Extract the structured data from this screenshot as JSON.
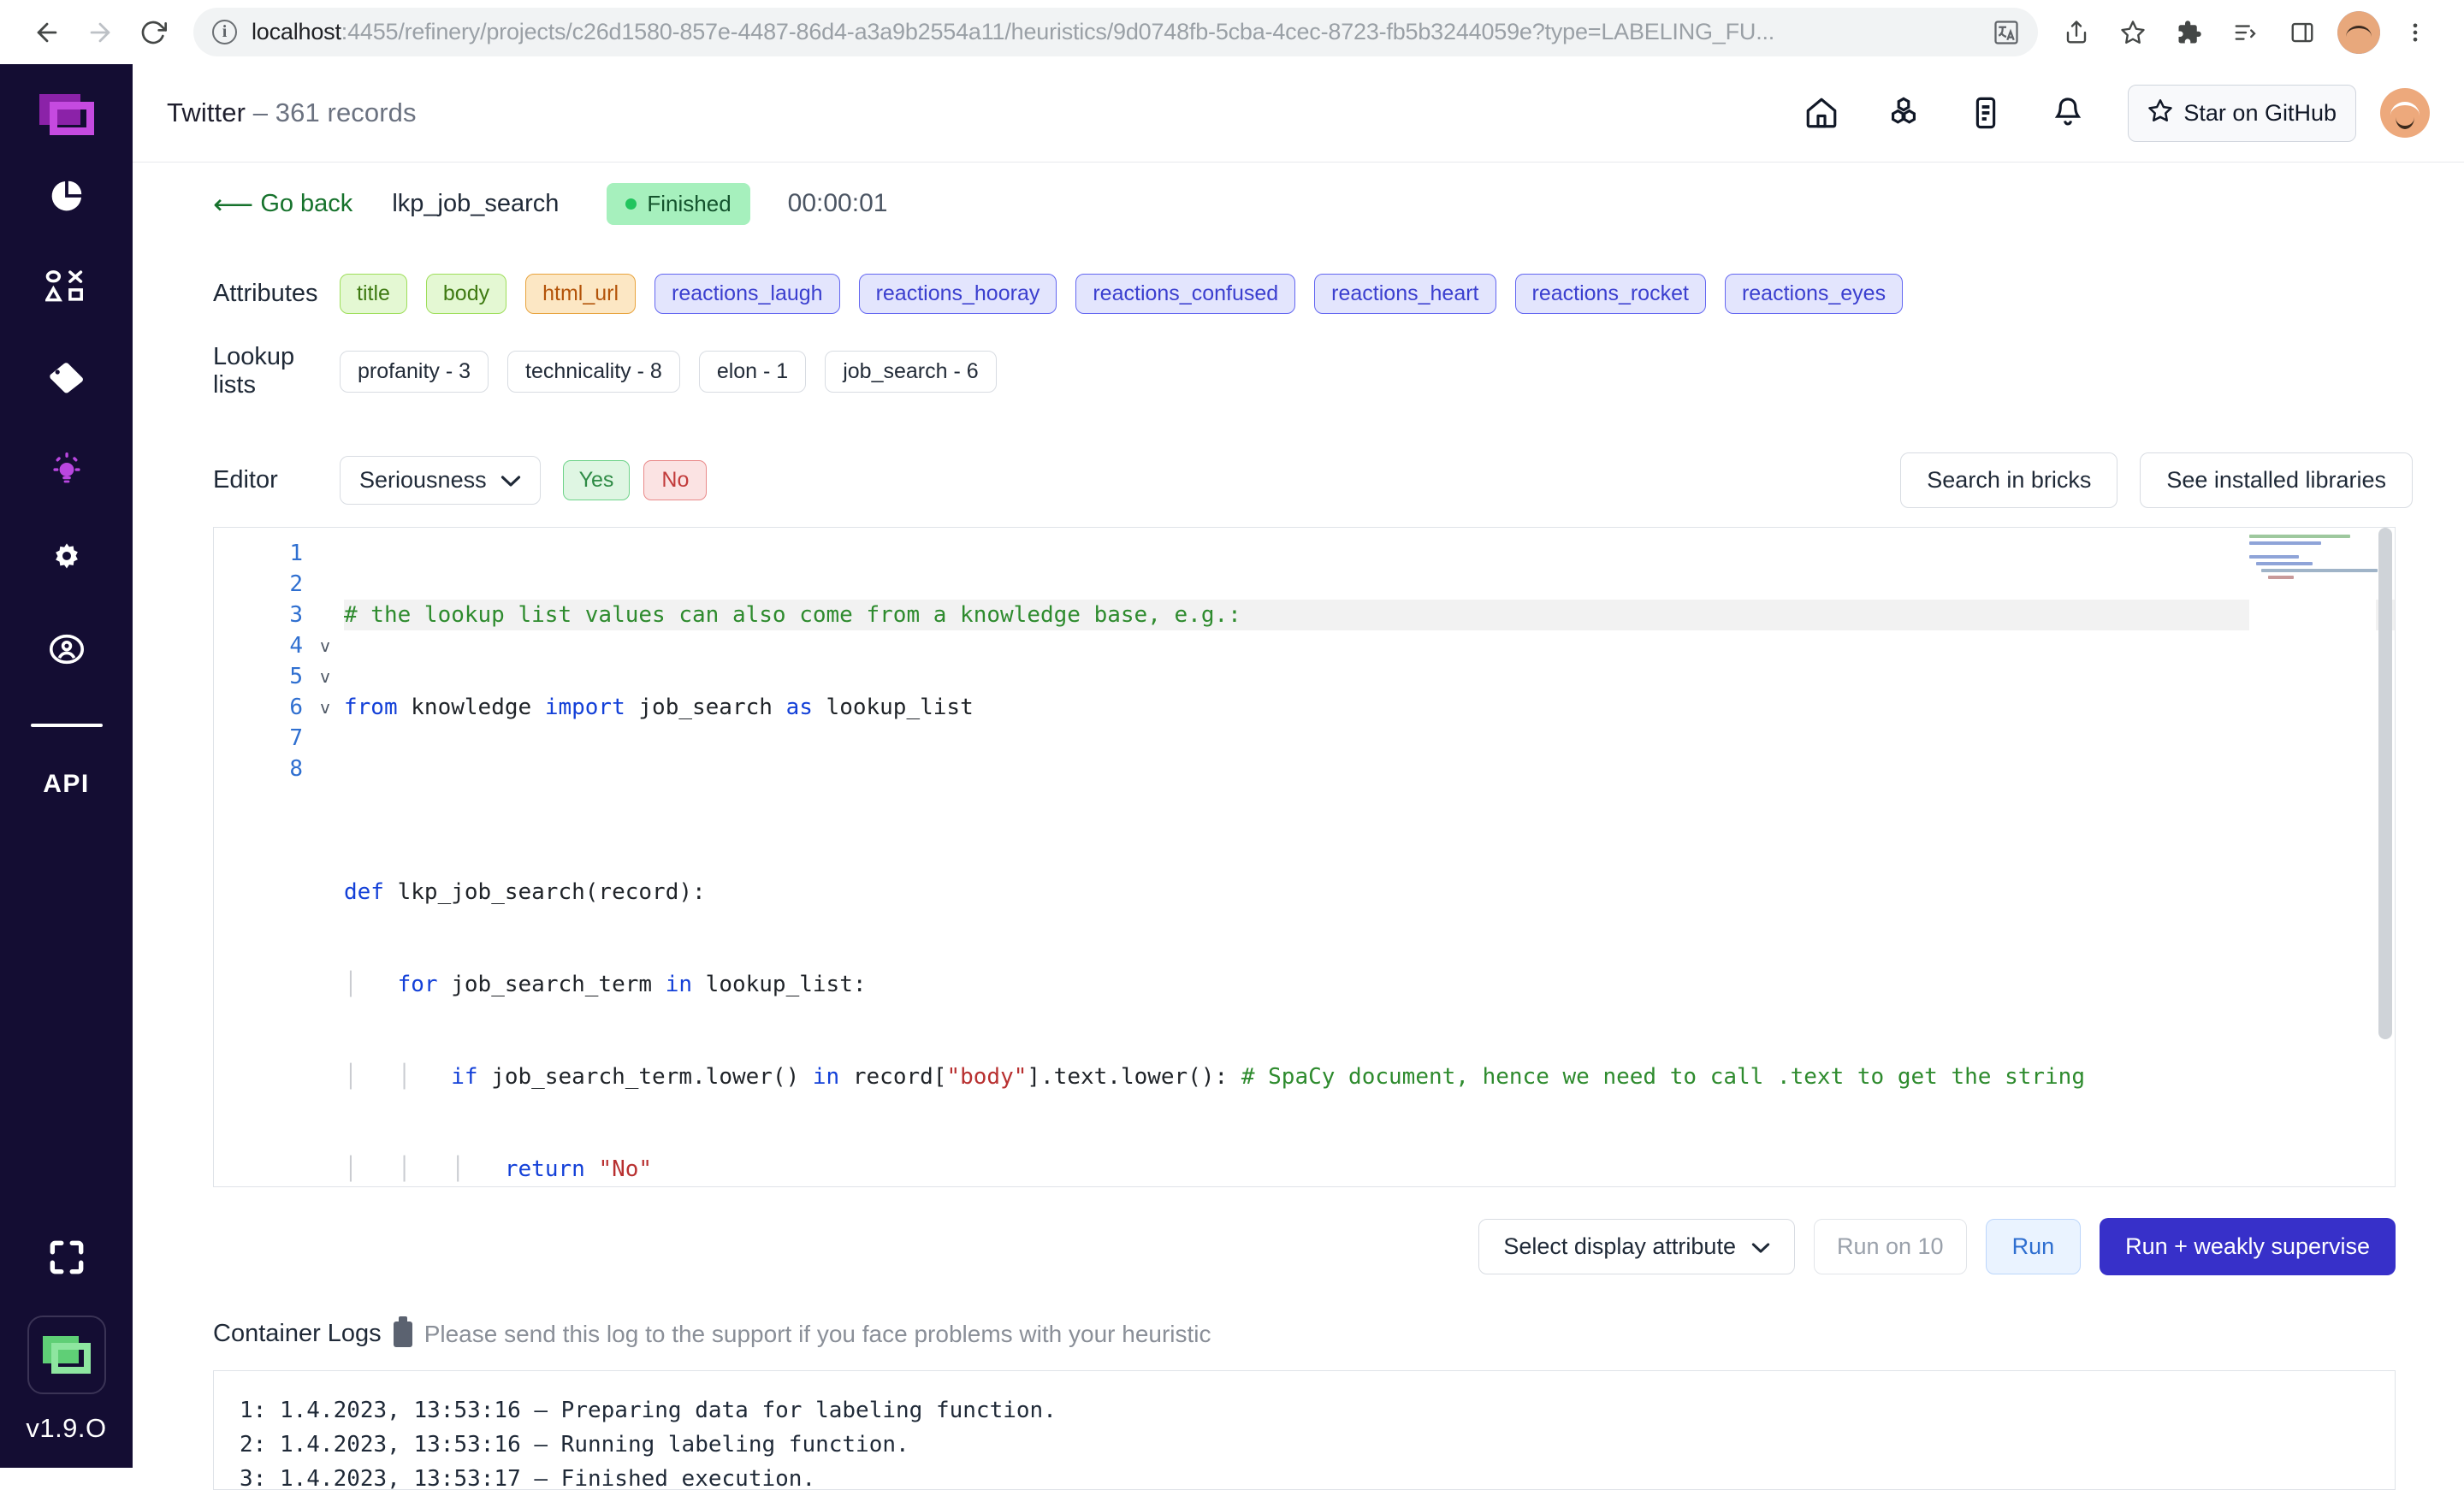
{
  "browser": {
    "url_host": "localhost",
    "url_rest": ":4455/refinery/projects/c26d1580-857e-4487-86d4-a3a9b2554a11/heuristics/9d0748fb-5cba-4cec-8723-fb5b3244059e?type=LABELING_FU...",
    "back_icon": "back-arrow-icon",
    "forward_icon": "forward-arrow-icon",
    "reload_icon": "reload-icon",
    "translate_icon": "translate-icon",
    "share_icon": "share-icon",
    "bookmark_icon": "star-icon",
    "extensions_icon": "puzzle-icon",
    "reading_list_icon": "reading-list-icon",
    "sidepanel_icon": "side-panel-icon",
    "menu_icon": "kebab-menu-icon"
  },
  "sidebar": {
    "logo": "refinery-logo",
    "items": [
      {
        "name": "overview-icon",
        "label": "Overview"
      },
      {
        "name": "data-browser-icon",
        "label": "Data browser"
      },
      {
        "name": "labeling-tag-icon",
        "label": "Labeling"
      },
      {
        "name": "heuristics-bulb-icon",
        "label": "Heuristics"
      },
      {
        "name": "settings-gear-icon",
        "label": "Settings"
      },
      {
        "name": "account-user-icon",
        "label": "Account"
      }
    ],
    "api_label": "API",
    "expand_icon": "fullscreen-expand-icon",
    "version": "v1.9.O"
  },
  "topbar": {
    "project_name": "Twitter",
    "separator": " – ",
    "record_count": "361 records",
    "icons": [
      {
        "name": "home-icon"
      },
      {
        "name": "models-icon"
      },
      {
        "name": "notes-icon"
      },
      {
        "name": "bell-notification-icon"
      }
    ],
    "github_label": "Star on GitHub",
    "github_star_icon": "star-outline-icon",
    "avatar": "user-avatar"
  },
  "heuristic": {
    "go_back_label": "Go back",
    "go_back_icon": "long-left-arrow-icon",
    "name": "lkp_job_search",
    "status": "Finished",
    "duration": "00:00:01"
  },
  "attributes": {
    "label": "Attributes",
    "items": [
      {
        "label": "title",
        "color": "green"
      },
      {
        "label": "body",
        "color": "green"
      },
      {
        "label": "html_url",
        "color": "orange"
      },
      {
        "label": "reactions_laugh",
        "color": "blue"
      },
      {
        "label": "reactions_hooray",
        "color": "blue"
      },
      {
        "label": "reactions_confused",
        "color": "blue"
      },
      {
        "label": "reactions_heart",
        "color": "blue"
      },
      {
        "label": "reactions_rocket",
        "color": "blue"
      },
      {
        "label": "reactions_eyes",
        "color": "blue"
      }
    ]
  },
  "lookup_lists": {
    "label": "Lookup lists",
    "items": [
      {
        "label": "profanity - 3"
      },
      {
        "label": "technicality - 8"
      },
      {
        "label": "elon - 1"
      },
      {
        "label": "job_search - 6"
      }
    ]
  },
  "editor_row": {
    "label": "Editor",
    "labeling_task": "Seriousness",
    "dropdown_icon": "chevron-down-icon",
    "yes_label": "Yes",
    "no_label": "No",
    "search_bricks_label": "Search in bricks",
    "installed_libs_label": "See installed libraries"
  },
  "code": {
    "line_numbers": [
      "1",
      "2",
      "3",
      "4",
      "5",
      "6",
      "7",
      "8"
    ],
    "lines": [
      "# the lookup list values can also come from a knowledge base, e.g.:",
      "from knowledge import job_search as lookup_list",
      "",
      "def lkp_job_search(record):",
      "    for job_search_term in lookup_list:",
      "        if job_search_term.lower() in record[\"body\"].text.lower(): # SpaCy document, hence we need to call .text to get the string",
      "            return \"No\"",
      ""
    ],
    "fold_markers": [
      "",
      "",
      "",
      "v",
      "v",
      "v",
      "",
      ""
    ]
  },
  "actions": {
    "select_display_attribute": "Select display attribute",
    "dropdown_icon": "chevron-down-icon",
    "run_on_10": "Run on 10",
    "run": "Run",
    "run_weakly_supervise": "Run + weakly supervise"
  },
  "logs": {
    "title": "Container Logs",
    "clipboard_icon": "clipboard-icon",
    "subtitle": "Please send this log to the support if you face problems with your heuristic",
    "entries": [
      "1: 1.4.2023, 13:53:16 – Preparing data for labeling function.",
      "2: 1.4.2023, 13:53:16 – Running labeling function.",
      "3: 1.4.2023, 13:53:17 – Finished execution."
    ]
  },
  "colors": {
    "sidebar_bg": "#140d33",
    "accent_purple": "#3730c9",
    "status_green_bg": "#a6f0bd",
    "attr_green": "#e4f8d3",
    "attr_orange": "#fce7c4",
    "attr_blue": "#e3e5fd"
  }
}
